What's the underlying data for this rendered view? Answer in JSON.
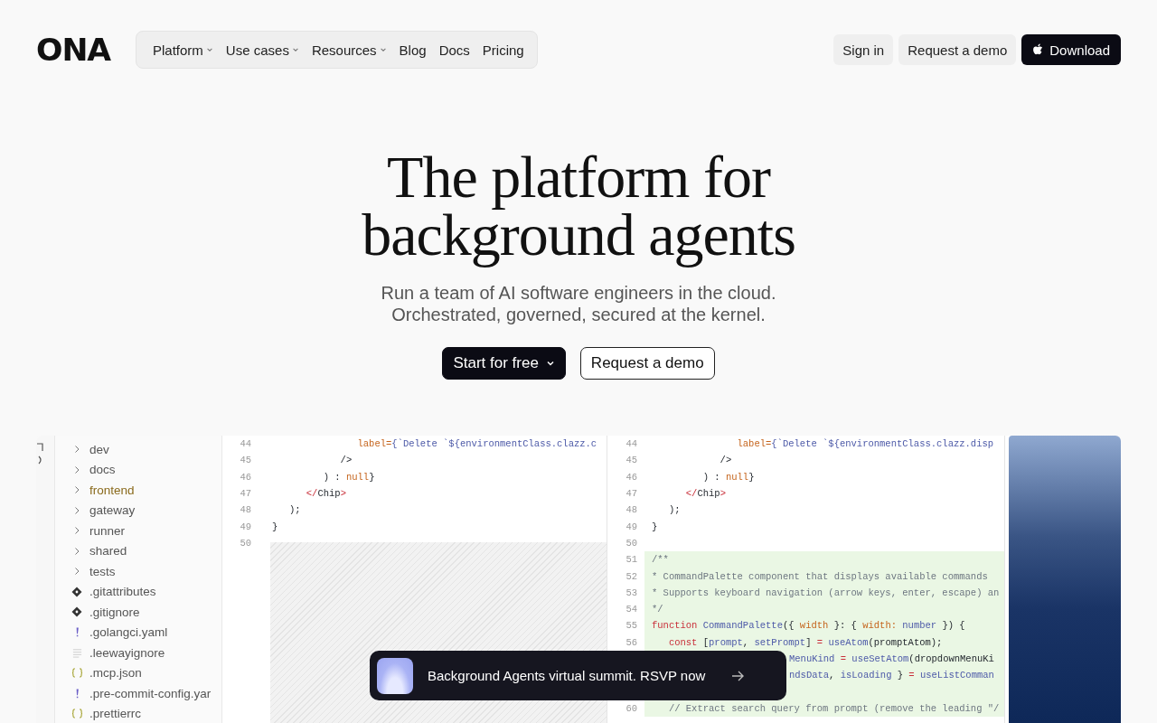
{
  "header": {
    "logo": "ONA",
    "nav": [
      {
        "label": "Platform",
        "has_menu": true
      },
      {
        "label": "Use cases",
        "has_menu": true
      },
      {
        "label": "Resources",
        "has_menu": true
      },
      {
        "label": "Blog",
        "has_menu": false
      },
      {
        "label": "Docs",
        "has_menu": false
      },
      {
        "label": "Pricing",
        "has_menu": false
      }
    ],
    "actions": [
      {
        "label": "Sign in",
        "kind": "light"
      },
      {
        "label": "Request a demo",
        "kind": "light"
      },
      {
        "label": "Download",
        "kind": "dark"
      }
    ]
  },
  "hero": {
    "title": "The platform for background agents",
    "subtitle": "Run a team of AI software engineers in the cloud. Orchestrated, governed, secured at the kernel.",
    "buttons": [
      {
        "label": "Start for free",
        "kind": "dark",
        "has_menu": true
      },
      {
        "label": "Request a demo",
        "kind": "outline",
        "has_menu": false
      }
    ]
  },
  "preview": {
    "file_tree": [
      {
        "name": "dev",
        "kind": "folder",
        "selected": false
      },
      {
        "name": "docs",
        "kind": "folder",
        "selected": false
      },
      {
        "name": "frontend",
        "kind": "folder",
        "selected": true
      },
      {
        "name": "gateway",
        "kind": "folder",
        "selected": false
      },
      {
        "name": "runner",
        "kind": "folder",
        "selected": false
      },
      {
        "name": "shared",
        "kind": "folder",
        "selected": false
      },
      {
        "name": "tests",
        "kind": "folder",
        "selected": false
      },
      {
        "name": ".gitattributes",
        "kind": "git",
        "selected": false
      },
      {
        "name": ".gitignore",
        "kind": "git",
        "selected": false
      },
      {
        "name": ".golangci.yaml",
        "kind": "yaml",
        "selected": false
      },
      {
        "name": ".leewayignore",
        "kind": "text",
        "selected": false
      },
      {
        "name": ".mcp.json",
        "kind": "json",
        "selected": false
      },
      {
        "name": ".pre-commit-config.yar",
        "kind": "yaml",
        "selected": false
      },
      {
        "name": ".prettierrc",
        "kind": "json",
        "selected": false
      }
    ],
    "left_editor": [
      {
        "number": "44",
        "added": false,
        "tokens": [
          {
            "text": "               label=",
            "kind": "param"
          },
          {
            "text": "{`Delete `${environmentClass.clazz.c",
            "kind": "fn"
          }
        ]
      },
      {
        "number": "45",
        "added": false,
        "tokens": [
          {
            "text": "            />",
            "kind": "plain"
          }
        ]
      },
      {
        "number": "46",
        "added": false,
        "tokens": [
          {
            "text": "         ) : ",
            "kind": "plain"
          },
          {
            "text": "null",
            "kind": "param"
          },
          {
            "text": "}",
            "kind": "plain"
          }
        ]
      },
      {
        "number": "47",
        "added": false,
        "tokens": [
          {
            "text": "      </",
            "kind": "keyword"
          },
          {
            "text": "Chip",
            "kind": "plain"
          },
          {
            "text": ">",
            "kind": "keyword"
          }
        ]
      },
      {
        "number": "48",
        "added": false,
        "tokens": [
          {
            "text": "   );",
            "kind": "plain"
          }
        ]
      },
      {
        "number": "49",
        "added": false,
        "tokens": [
          {
            "text": "}",
            "kind": "plain"
          }
        ]
      },
      {
        "number": "50",
        "added": false
      }
    ],
    "right_editor": [
      {
        "number": "44",
        "added": false,
        "tokens": [
          {
            "text": "               label=",
            "kind": "param"
          },
          {
            "text": "{`Delete `${environmentClass.clazz.disp",
            "kind": "fn"
          }
        ]
      },
      {
        "number": "45",
        "added": false,
        "tokens": [
          {
            "text": "            />",
            "kind": "plain"
          }
        ]
      },
      {
        "number": "46",
        "added": false,
        "tokens": [
          {
            "text": "         ) : ",
            "kind": "plain"
          },
          {
            "text": "null",
            "kind": "param"
          },
          {
            "text": "}",
            "kind": "plain"
          }
        ]
      },
      {
        "number": "47",
        "added": false,
        "tokens": [
          {
            "text": "      </",
            "kind": "keyword"
          },
          {
            "text": "Chip",
            "kind": "plain"
          },
          {
            "text": ">",
            "kind": "keyword"
          }
        ]
      },
      {
        "number": "48",
        "added": false,
        "tokens": [
          {
            "text": "   );",
            "kind": "plain"
          }
        ]
      },
      {
        "number": "49",
        "added": false,
        "tokens": [
          {
            "text": "}",
            "kind": "plain"
          }
        ]
      },
      {
        "number": "50",
        "added": false
      },
      {
        "number": "51",
        "added": true,
        "tokens": [
          {
            "text": "/**",
            "kind": "comment"
          }
        ]
      },
      {
        "number": "52",
        "added": true,
        "tokens": [
          {
            "text": "* CommandPalette component that displays available commands",
            "kind": "comment"
          }
        ]
      },
      {
        "number": "53",
        "added": true,
        "tokens": [
          {
            "text": "* Supports keyboard navigation (arrow keys, enter, escape) an",
            "kind": "comment"
          }
        ]
      },
      {
        "number": "54",
        "added": true,
        "tokens": [
          {
            "text": "*/",
            "kind": "comment"
          }
        ]
      },
      {
        "number": "55",
        "added": true,
        "tokens": [
          {
            "text": "function ",
            "kind": "keyword"
          },
          {
            "text": "CommandPalette",
            "kind": "fn"
          },
          {
            "text": "({ ",
            "kind": "plain"
          },
          {
            "text": "width",
            "kind": "param"
          },
          {
            "text": " }: { ",
            "kind": "plain"
          },
          {
            "text": "width:",
            "kind": "param"
          },
          {
            "text": " number",
            "kind": "fn"
          },
          {
            "text": " }) {",
            "kind": "plain"
          }
        ]
      },
      {
        "number": "56",
        "added": true,
        "tokens": [
          {
            "text": "   const ",
            "kind": "keyword"
          },
          {
            "text": "[",
            "kind": "plain"
          },
          {
            "text": "prompt",
            "kind": "fn"
          },
          {
            "text": ", ",
            "kind": "plain"
          },
          {
            "text": "setPrompt",
            "kind": "fn"
          },
          {
            "text": "] ",
            "kind": "plain"
          },
          {
            "text": "= ",
            "kind": "keyword"
          },
          {
            "text": "useAtom",
            "kind": "fn"
          },
          {
            "text": "(promptAtom);",
            "kind": "plain"
          }
        ]
      },
      {
        "added": true,
        "partial": true,
        "tokens": [
          {
            "text": "MenuKind ",
            "kind": "fn"
          },
          {
            "text": "= ",
            "kind": "keyword"
          },
          {
            "text": "useSetAtom",
            "kind": "fn"
          },
          {
            "text": "(dropdownMenuKi",
            "kind": "plain"
          }
        ]
      },
      {
        "added": true,
        "partial": true,
        "tokens": [
          {
            "text": "ndsData",
            "kind": "fn"
          },
          {
            "text": ", ",
            "kind": "plain"
          },
          {
            "text": "isLoading",
            "kind": "fn"
          },
          {
            "text": " } ",
            "kind": "plain"
          },
          {
            "text": "= ",
            "kind": "keyword"
          },
          {
            "text": "useListComman",
            "kind": "fn"
          }
        ]
      },
      {
        "added": true
      },
      {
        "number": "60",
        "added": true,
        "tokens": [
          {
            "text": "   // Extract search query from prompt (remove the leading \"/",
            "kind": "comment"
          }
        ]
      }
    ]
  },
  "banner": {
    "text": "Background Agents virtual summit. RSVP now"
  }
}
